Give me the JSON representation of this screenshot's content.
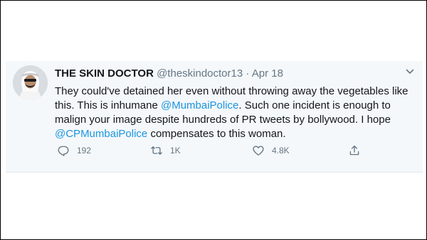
{
  "tweet": {
    "display_name": "THE SKIN DOCTOR",
    "handle": "@theskindoctor13",
    "separator": "·",
    "date": "Apr 18",
    "text_part1": "They could've detained her even without throwing away the vegetables like this. This is inhumane ",
    "mention1": "@MumbaiPolice",
    "text_part2": ". Such one incident is enough to malign your image despite hundreds of PR tweets by bollywood. I hope ",
    "mention2": "@CPMumbaiPolice",
    "text_part3": " compensates to this woman.",
    "reply_count": "192",
    "retweet_count": "1K",
    "like_count": "4.8K"
  },
  "icons": {
    "caret": "chevron-down-icon",
    "reply": "reply-icon",
    "retweet": "retweet-icon",
    "like": "heart-icon",
    "share": "share-icon"
  },
  "colors": {
    "card_background": "#f5f8fa",
    "link": "#1b95e0",
    "secondary_text": "#657786",
    "primary_text": "#14171a"
  }
}
